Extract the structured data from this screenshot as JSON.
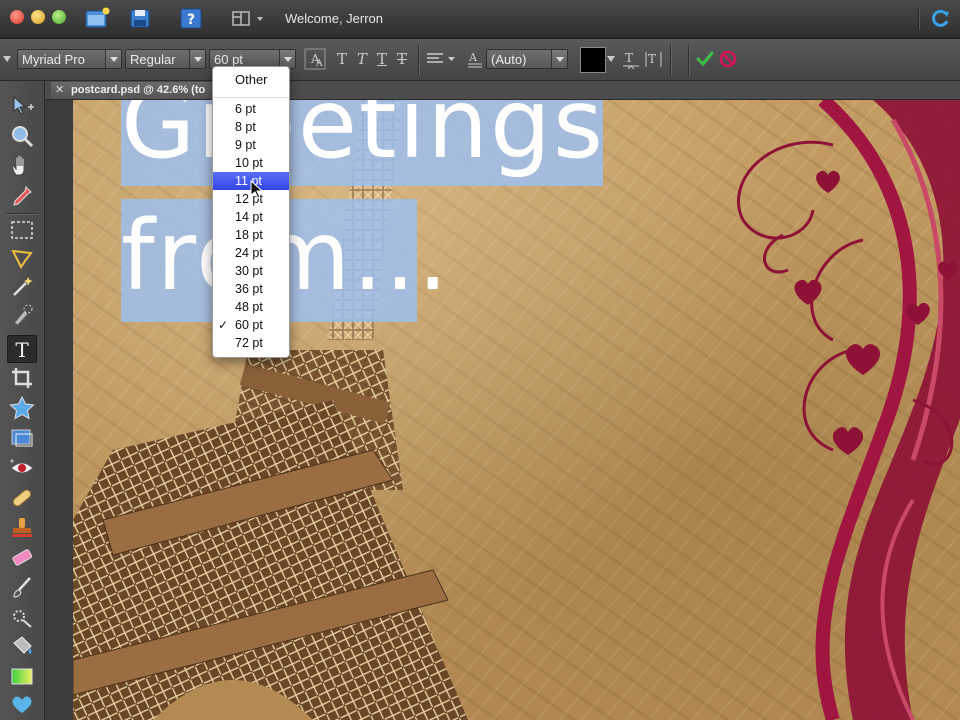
{
  "topbar": {
    "welcome_text": "Welcome, Jerron"
  },
  "options_bar": {
    "font_family": "Myriad Pro",
    "font_style": "Regular",
    "font_size": "60 pt",
    "leading": "(Auto)",
    "text_color": "#000000"
  },
  "document": {
    "tab_title": "postcard.psd @ 42.6% (to",
    "headline_line1": "Greetings",
    "headline_line2": "from..."
  },
  "size_menu": {
    "other_label": "Other",
    "items": [
      {
        "label": "6 pt"
      },
      {
        "label": "8 pt"
      },
      {
        "label": "9 pt"
      },
      {
        "label": "10 pt"
      },
      {
        "label": "11 pt"
      },
      {
        "label": "12 pt"
      },
      {
        "label": "14 pt"
      },
      {
        "label": "18 pt"
      },
      {
        "label": "24 pt"
      },
      {
        "label": "30 pt"
      },
      {
        "label": "36 pt"
      },
      {
        "label": "48 pt"
      },
      {
        "label": "60 pt"
      },
      {
        "label": "72 pt"
      }
    ],
    "highlighted": "11 pt",
    "checked": "60 pt",
    "checkmark": "✓"
  },
  "colors": {
    "accent_highlight": "#3f51ee",
    "commit_green": "#39b54a",
    "cancel_red": "#d4145a",
    "swirl_red": "#8e1236",
    "selection_blue": "#9ebeee"
  },
  "icons": {
    "tools": [
      "move-icon",
      "zoom-icon",
      "hand-icon",
      "eyedropper-icon",
      "marquee-icon",
      "lasso-icon",
      "magic-wand-icon",
      "quick-selection-icon",
      "type-icon",
      "crop-icon",
      "cookie-cutter-icon",
      "straighten-icon",
      "red-eye-icon",
      "healing-brush-icon",
      "clone-stamp-icon",
      "eraser-icon",
      "brush-icon",
      "smart-brush-icon",
      "paint-bucket-icon",
      "gradient-icon",
      "shape-icon"
    ]
  }
}
